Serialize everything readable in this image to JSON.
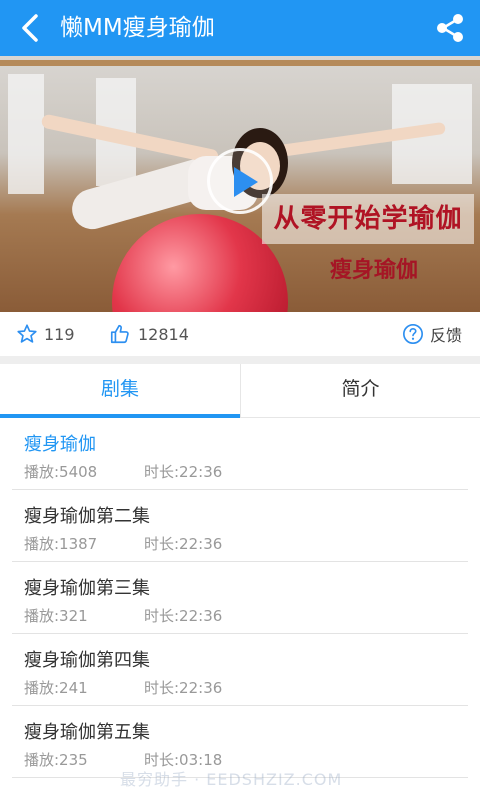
{
  "header": {
    "title": "懒MM瘦身瑜伽"
  },
  "video": {
    "banner_title": "从零开始学瑜伽",
    "banner_subtitle": "瘦身瑜伽"
  },
  "stats": {
    "favorites": "119",
    "likes": "12814",
    "feedback_label": "反馈"
  },
  "tabs": [
    {
      "label": "剧集",
      "active": true
    },
    {
      "label": "简介",
      "active": false
    }
  ],
  "episodes": [
    {
      "title": "瘦身瑜伽",
      "plays": "播放:5408",
      "duration": "时长:22:36",
      "current": true
    },
    {
      "title": "瘦身瑜伽第二集",
      "plays": "播放:1387",
      "duration": "时长:22:36"
    },
    {
      "title": "瘦身瑜伽第三集",
      "plays": "播放:321",
      "duration": "时长:22:36"
    },
    {
      "title": "瘦身瑜伽第四集",
      "plays": "播放:241",
      "duration": "时长:22:36"
    },
    {
      "title": "瘦身瑜伽第五集",
      "plays": "播放:235",
      "duration": "时长:03:18"
    }
  ],
  "watermark": "最穷助手 · EEDSHZIZ.COM",
  "colors": {
    "accent": "#2196f3",
    "banner_text": "#b01324"
  }
}
